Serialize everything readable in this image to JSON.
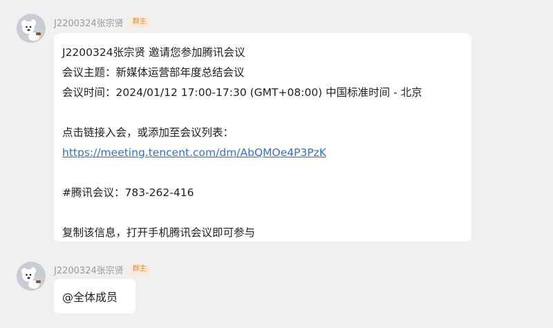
{
  "messages": [
    {
      "sender": "J2200324张宗贤",
      "role_badge": "群主",
      "lines": [
        "J2200324张宗贤 邀请您参加腾讯会议",
        "会议主题：新媒体运营部年度总结会议",
        "会议时间：2024/01/12 17:00-17:30 (GMT+08:00) 中国标准时间 - 北京",
        "",
        "点击链接入会，或添加至会议列表：",
        "https://meeting.tencent.com/dm/AbQMOe4P3PzK",
        "",
        "#腾讯会议：783-262-416",
        "",
        "复制该信息，打开手机腾讯会议即可参与"
      ]
    },
    {
      "sender": "J2200324张宗贤",
      "role_badge": "群主",
      "text": "@全体成员"
    }
  ],
  "colors": {
    "background": "#f0f0f0",
    "bubble": "#ffffff",
    "link": "#2f6fd6",
    "badge_bg": "#fde9d7",
    "badge_text": "#e08a3c",
    "sender_text": "#9a9a9a"
  },
  "icons": {
    "avatar": "cartoon-dog-avatar"
  }
}
